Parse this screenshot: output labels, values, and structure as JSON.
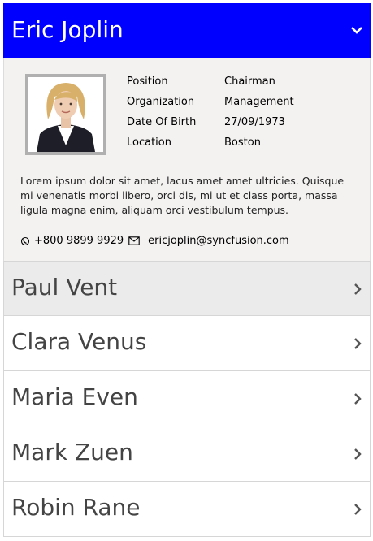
{
  "header": {
    "name": "Eric Joplin"
  },
  "profile": {
    "fields": [
      {
        "label": "Position",
        "value": "Chairman"
      },
      {
        "label": "Organization",
        "value": "Management"
      },
      {
        "label": "Date Of Birth",
        "value": "27/09/1973"
      },
      {
        "label": "Location",
        "value": "Boston"
      }
    ],
    "description": "Lorem ipsum dolor sit amet, lacus amet amet ultricies. Quisque mi venenatis morbi libero, orci dis, mi ut et class porta, massa ligula magna enim, aliquam orci vestibulum tempus.",
    "phone": "+800 9899 9929",
    "email": "ericjoplin@syncfusion.com"
  },
  "items": [
    {
      "name": "Paul Vent"
    },
    {
      "name": "Clara Venus"
    },
    {
      "name": "Maria Even"
    },
    {
      "name": "Mark Zuen"
    },
    {
      "name": "Robin Rane"
    }
  ],
  "colors": {
    "header_bg": "#0000ff",
    "content_bg": "#f3f2f1",
    "hover_item_bg": "#ebebeb"
  },
  "icons": {
    "expanded": "chevron-down-icon",
    "collapsed": "chevron-right-icon",
    "phone": "phone-icon",
    "email": "envelope-icon"
  }
}
